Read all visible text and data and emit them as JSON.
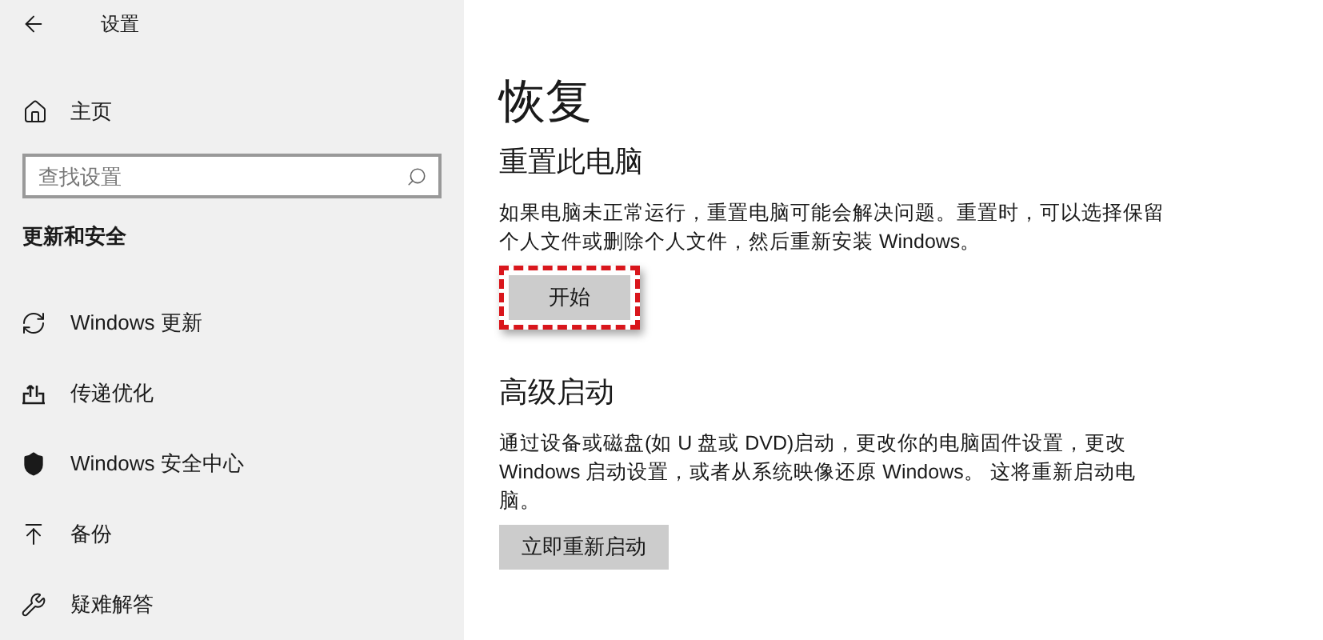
{
  "window": {
    "title": "设置"
  },
  "sidebar": {
    "home": "主页",
    "search": {
      "placeholder": "查找设置"
    },
    "section_title": "更新和安全",
    "items": [
      {
        "kind": "update",
        "label": "Windows 更新"
      },
      {
        "kind": "delivery",
        "label": "传递优化"
      },
      {
        "kind": "security",
        "label": "Windows 安全中心"
      },
      {
        "kind": "backup",
        "label": "备份"
      },
      {
        "kind": "troubleshoot",
        "label": "疑难解答"
      }
    ]
  },
  "main": {
    "title": "恢复",
    "sections": [
      {
        "heading": "重置此电脑",
        "text": "如果电脑未正常运行，重置电脑可能会解决问题。重置时，可以选择保留个人文件或删除个人文件，然后重新安装 Windows。",
        "button": "开始",
        "highlighted": true
      },
      {
        "heading": "高级启动",
        "text": "通过设备或磁盘(如 U 盘或 DVD)启动，更改你的电脑固件设置，更改 Windows 启动设置，或者从系统映像还原 Windows。 这将重新启动电脑。",
        "button": "立即重新启动",
        "highlighted": false
      }
    ]
  }
}
